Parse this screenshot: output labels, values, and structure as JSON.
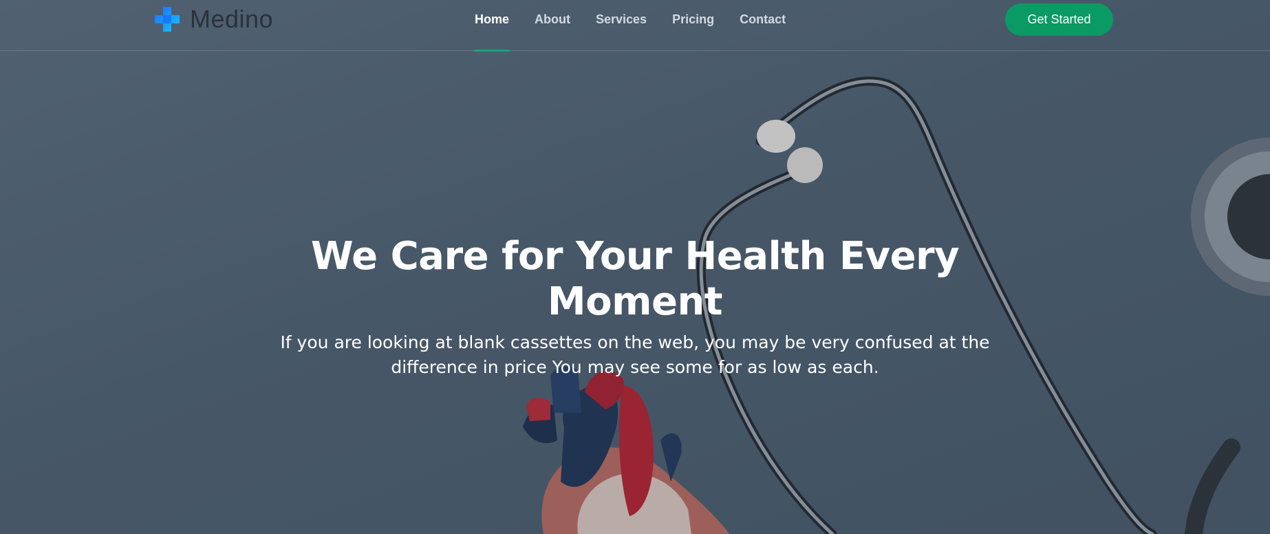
{
  "brand": {
    "name": "Medino",
    "logo_icon": "medical-cross-icon",
    "logo_colors": [
      "#1f6bff",
      "#12c8ff"
    ]
  },
  "nav": {
    "items": [
      {
        "label": "Home",
        "active": true
      },
      {
        "label": "About",
        "active": false
      },
      {
        "label": "Services",
        "active": false
      },
      {
        "label": "Pricing",
        "active": false
      },
      {
        "label": "Contact",
        "active": false
      }
    ]
  },
  "cta": {
    "label": "Get Started",
    "color": "#0a9a64"
  },
  "hero": {
    "title": "We Care for Your Health Every Moment",
    "subtitle": "If you are looking at blank cassettes on the web, you may be very confused at the difference in price You may see some for as low as each.",
    "background_icons": [
      "stethoscope-icon",
      "heart-model-icon"
    ]
  },
  "colors": {
    "active_underline": "#16a37a",
    "background": "#4e6070"
  }
}
